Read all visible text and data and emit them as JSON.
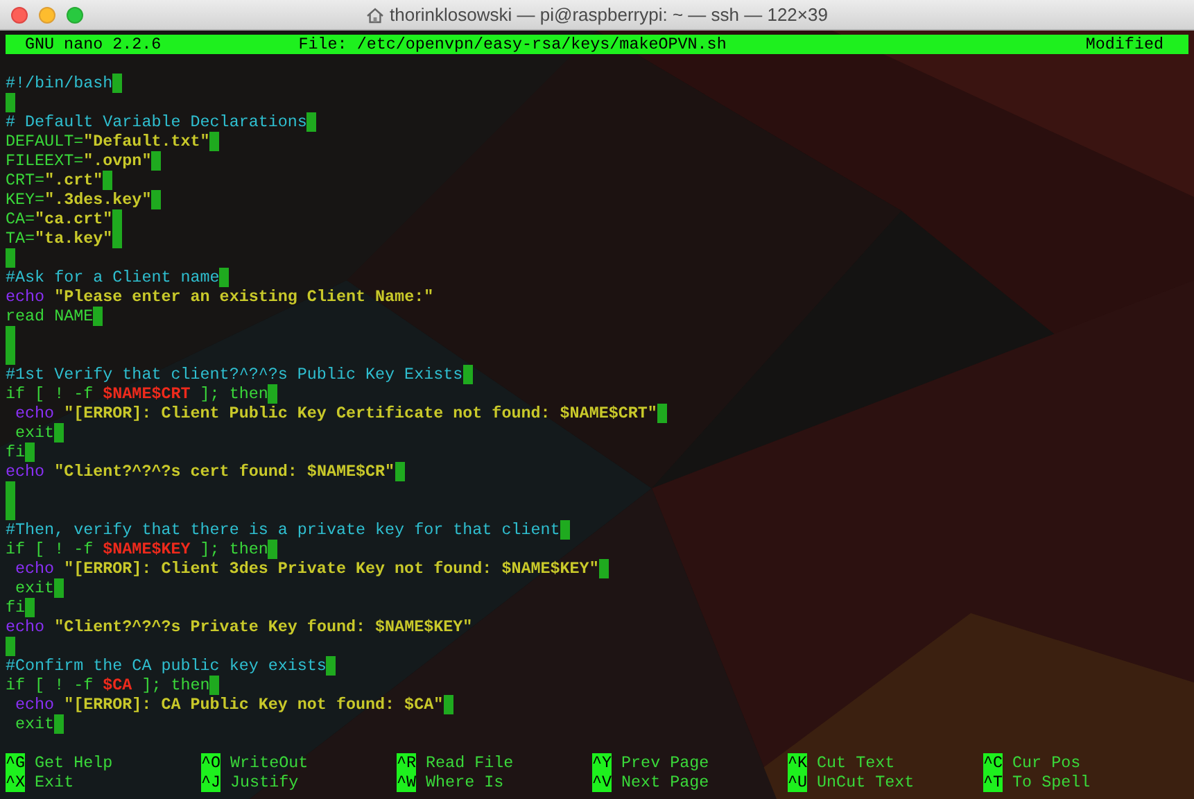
{
  "window": {
    "title": "thorinklosowski — pi@raspberrypi: ~ — ssh — 122×39"
  },
  "nano_header": {
    "app": "GNU nano 2.2.6",
    "file": "File: /etc/openvpn/easy-rsa/keys/makeOPVN.sh",
    "status": "Modified"
  },
  "lines": [
    {
      "segments": [
        {
          "kind": "comment",
          "text": "#!/bin/bash"
        }
      ],
      "trailing_space": true
    },
    {
      "trailing_space": true
    },
    {
      "segments": [
        {
          "kind": "comment",
          "text": "# Default Variable Declarations"
        }
      ],
      "trailing_space": true
    },
    {
      "segments": [
        {
          "kind": "code",
          "text": "DEFAULT="
        },
        {
          "kind": "string",
          "text": "\"Default.txt\""
        }
      ],
      "trailing_space": true
    },
    {
      "segments": [
        {
          "kind": "code",
          "text": "FILEEXT="
        },
        {
          "kind": "string",
          "text": "\".ovpn\""
        }
      ],
      "trailing_space": true
    },
    {
      "segments": [
        {
          "kind": "code",
          "text": "CRT="
        },
        {
          "kind": "string",
          "text": "\".crt\""
        }
      ],
      "trailing_space": true
    },
    {
      "segments": [
        {
          "kind": "code",
          "text": "KEY="
        },
        {
          "kind": "string",
          "text": "\".3des.key\""
        }
      ],
      "trailing_space": true
    },
    {
      "segments": [
        {
          "kind": "code",
          "text": "CA="
        },
        {
          "kind": "string",
          "text": "\"ca.crt\""
        }
      ],
      "trailing_space": true
    },
    {
      "segments": [
        {
          "kind": "code",
          "text": "TA="
        },
        {
          "kind": "string",
          "text": "\"ta.key\""
        }
      ],
      "trailing_space": true
    },
    {
      "trailing_space": true
    },
    {
      "segments": [
        {
          "kind": "comment",
          "text": "#Ask for a Client name"
        }
      ],
      "trailing_space": true
    },
    {
      "segments": [
        {
          "kind": "keyword",
          "text": "echo"
        },
        {
          "kind": "string",
          "text": " \"Please enter an existing Client Name:\""
        }
      ],
      "trailing_space": false
    },
    {
      "segments": [
        {
          "kind": "code",
          "text": "read NAME"
        }
      ],
      "trailing_space": true
    },
    {
      "trailing_space": true
    },
    {
      "trailing_space": true
    },
    {
      "segments": [
        {
          "kind": "comment",
          "text": "#1st Verify that client?^?^?s Public Key Exists"
        }
      ],
      "trailing_space": true
    },
    {
      "segments": [
        {
          "kind": "code",
          "text": "if [ ! -f "
        },
        {
          "kind": "variable",
          "text": "$NAME$CRT"
        },
        {
          "kind": "code",
          "text": " ]; then"
        }
      ],
      "trailing_space": true
    },
    {
      "indented": true,
      "segments": [
        {
          "kind": "keyword",
          "text": "echo"
        },
        {
          "kind": "string",
          "text": " \"[ERROR]: Client Public Key Certificate not found: $NAME$CRT\""
        }
      ],
      "trailing_space": true
    },
    {
      "indented": true,
      "segments": [
        {
          "kind": "code",
          "text": "exit"
        }
      ],
      "trailing_space": true
    },
    {
      "segments": [
        {
          "kind": "code",
          "text": "fi"
        }
      ],
      "trailing_space": true
    },
    {
      "segments": [
        {
          "kind": "keyword",
          "text": "echo"
        },
        {
          "kind": "string",
          "text": " \"Client?^?^?s cert found: $NAME$CR\""
        }
      ],
      "trailing_space": true
    },
    {
      "trailing_space": true
    },
    {
      "trailing_space": true
    },
    {
      "segments": [
        {
          "kind": "comment",
          "text": "#Then, verify that there is a private key for that client"
        }
      ],
      "trailing_space": true
    },
    {
      "segments": [
        {
          "kind": "code",
          "text": "if [ ! -f "
        },
        {
          "kind": "variable",
          "text": "$NAME$KEY"
        },
        {
          "kind": "code",
          "text": " ]; then"
        }
      ],
      "trailing_space": true
    },
    {
      "indented": true,
      "segments": [
        {
          "kind": "keyword",
          "text": "echo"
        },
        {
          "kind": "string",
          "text": " \"[ERROR]: Client 3des Private Key not found: $NAME$KEY\""
        }
      ],
      "trailing_space": true
    },
    {
      "indented": true,
      "segments": [
        {
          "kind": "code",
          "text": "exit"
        }
      ],
      "trailing_space": true
    },
    {
      "segments": [
        {
          "kind": "code",
          "text": "fi"
        }
      ],
      "trailing_space": true
    },
    {
      "segments": [
        {
          "kind": "keyword",
          "text": "echo"
        },
        {
          "kind": "string",
          "text": " \"Client?^?^?s Private Key found: $NAME$KEY\""
        }
      ],
      "trailing_space": false
    },
    {
      "trailing_space": true
    },
    {
      "segments": [
        {
          "kind": "comment",
          "text": "#Confirm the CA public key exists"
        }
      ],
      "trailing_space": true
    },
    {
      "segments": [
        {
          "kind": "code",
          "text": "if [ ! -f "
        },
        {
          "kind": "variable",
          "text": "$CA"
        },
        {
          "kind": "code",
          "text": " ]; then"
        }
      ],
      "trailing_space": true
    },
    {
      "indented": true,
      "segments": [
        {
          "kind": "keyword",
          "text": "echo"
        },
        {
          "kind": "string",
          "text": " \"[ERROR]: CA Public Key not found: $CA\""
        }
      ],
      "trailing_space": true
    },
    {
      "indented": true,
      "segments": [
        {
          "kind": "code",
          "text": "exit"
        }
      ],
      "trailing_space": true
    }
  ],
  "shortcuts": [
    {
      "key": "^G",
      "label": "Get Help"
    },
    {
      "key": "^O",
      "label": "WriteOut"
    },
    {
      "key": "^R",
      "label": "Read File"
    },
    {
      "key": "^Y",
      "label": "Prev Page"
    },
    {
      "key": "^K",
      "label": "Cut Text"
    },
    {
      "key": "^C",
      "label": "Cur Pos"
    },
    {
      "key": "^X",
      "label": "Exit"
    },
    {
      "key": "^J",
      "label": "Justify"
    },
    {
      "key": "^W",
      "label": "Where Is"
    },
    {
      "key": "^V",
      "label": "Next Page"
    },
    {
      "key": "^U",
      "label": "UnCut Text"
    },
    {
      "key": "^T",
      "label": "To Spell"
    }
  ]
}
